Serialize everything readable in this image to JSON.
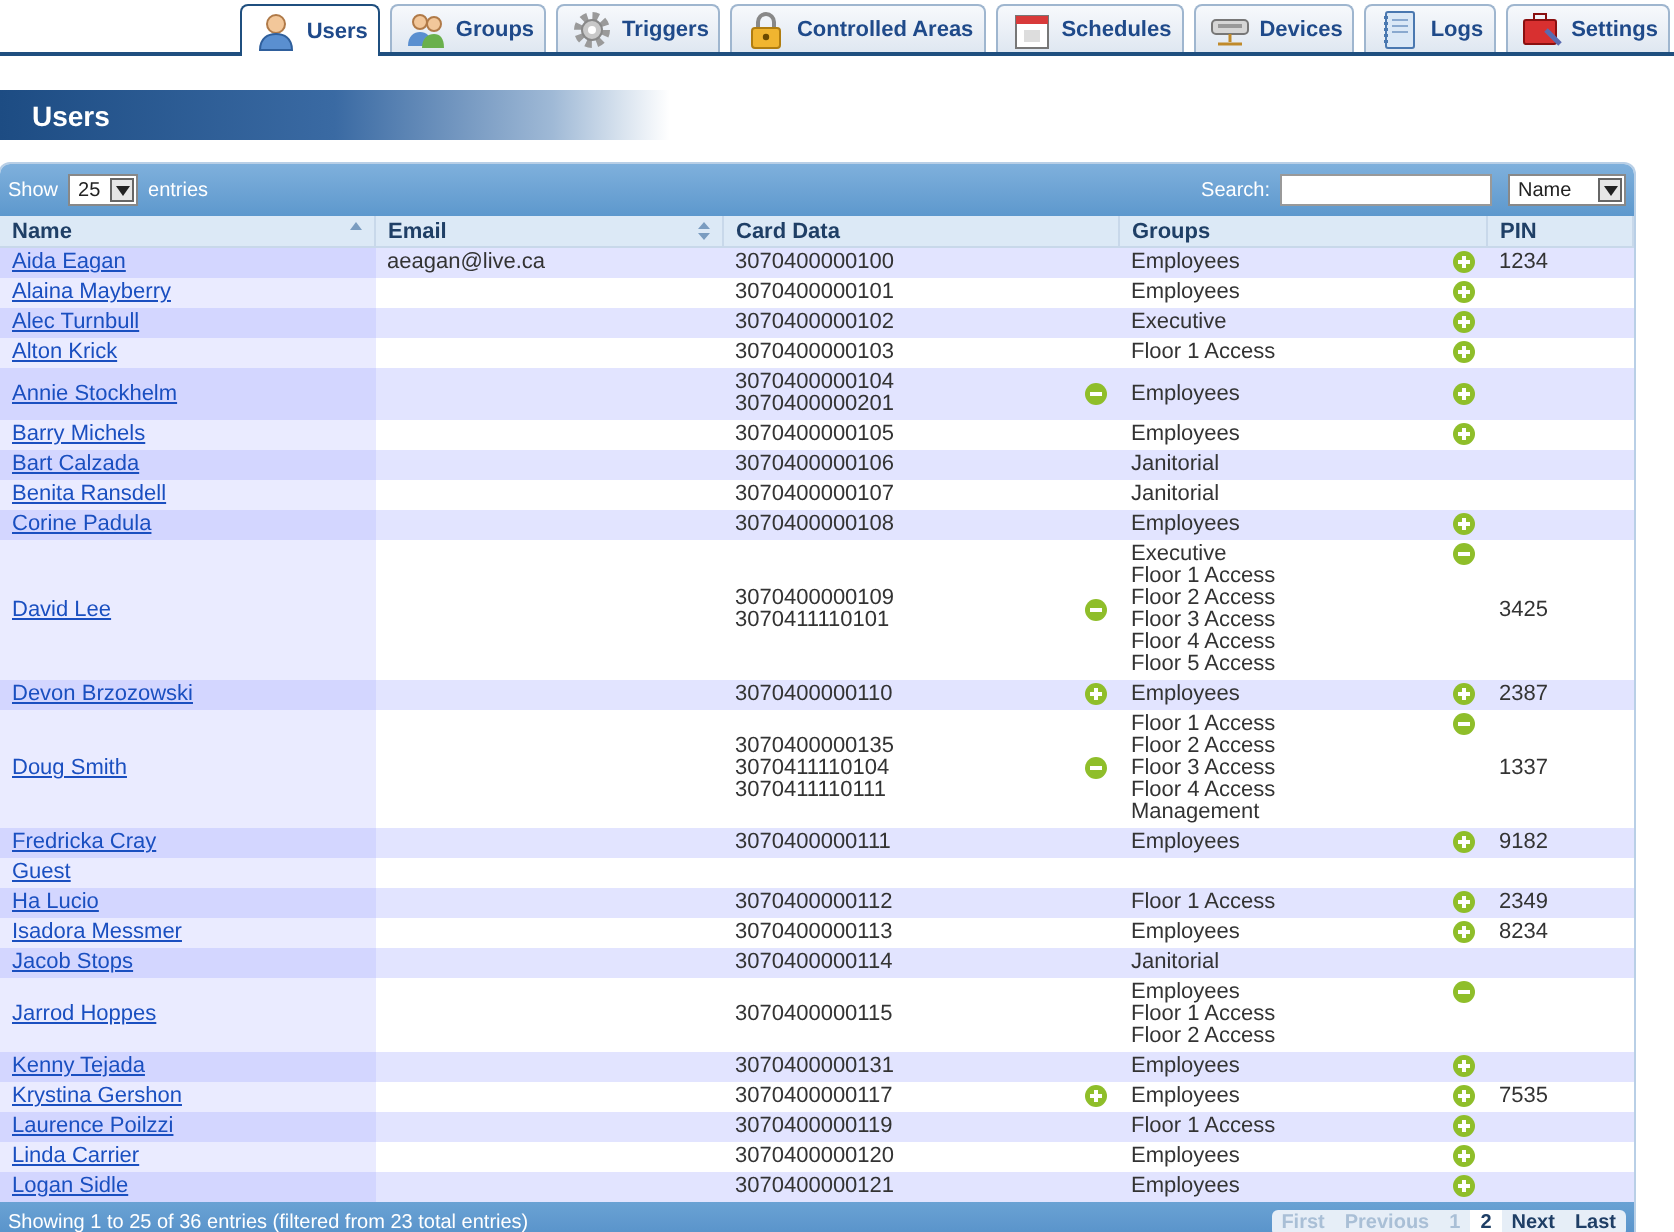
{
  "tabs": [
    {
      "label": "Users",
      "selected": true
    },
    {
      "label": "Groups",
      "selected": false
    },
    {
      "label": "Triggers",
      "selected": false
    },
    {
      "label": "Controlled Areas",
      "selected": false
    },
    {
      "label": "Schedules",
      "selected": false
    },
    {
      "label": "Devices",
      "selected": false
    },
    {
      "label": "Logs",
      "selected": false
    },
    {
      "label": "Settings",
      "selected": false
    }
  ],
  "page_title": "Users",
  "toolbar": {
    "show_label": "Show",
    "page_size": "25",
    "entries_label": "entries",
    "search_label": "Search:",
    "search_field": "Name"
  },
  "columns": [
    {
      "label": "Name",
      "kind": "ascending"
    },
    {
      "label": "Email",
      "kind": "sortable"
    },
    {
      "label": "Card Data",
      "kind": "plain"
    },
    {
      "label": "Groups",
      "kind": "plain"
    },
    {
      "label": "PIN",
      "kind": "plain"
    }
  ],
  "rows": [
    {
      "name": "Aida Eagan",
      "email": "aeagan@live.ca",
      "cards": [
        "3070400000100"
      ],
      "groups": [
        "Employees"
      ],
      "groups_expanded": false,
      "pin": "1234"
    },
    {
      "name": "Alaina Mayberry",
      "cards": [
        "3070400000101"
      ],
      "groups": [
        "Employees"
      ],
      "groups_expanded": false
    },
    {
      "name": "Alec Turnbull",
      "cards": [
        "3070400000102"
      ],
      "groups": [
        "Executive"
      ],
      "groups_expanded": false
    },
    {
      "name": "Alton Krick",
      "cards": [
        "3070400000103"
      ],
      "groups": [
        "Floor 1 Access"
      ],
      "groups_expanded": false
    },
    {
      "name": "Annie Stockhelm",
      "cards": [
        "3070400000104",
        "3070400000201"
      ],
      "cards_expanded": true,
      "groups": [
        "Employees"
      ],
      "groups_expanded": false
    },
    {
      "name": "Barry Michels",
      "cards": [
        "3070400000105"
      ],
      "groups": [
        "Employees"
      ],
      "groups_expanded": false
    },
    {
      "name": "Bart Calzada",
      "cards": [
        "3070400000106"
      ],
      "groups": [
        "Janitorial"
      ]
    },
    {
      "name": "Benita Ransdell",
      "cards": [
        "3070400000107"
      ],
      "groups": [
        "Janitorial"
      ]
    },
    {
      "name": "Corine Padula",
      "cards": [
        "3070400000108"
      ],
      "groups": [
        "Employees"
      ],
      "groups_expanded": false
    },
    {
      "name": "David Lee",
      "cards": [
        "3070400000109",
        "3070411110101"
      ],
      "cards_expanded": true,
      "groups": [
        "Executive",
        "Floor 1 Access",
        "Floor 2 Access",
        "Floor 3 Access",
        "Floor 4 Access",
        "Floor 5 Access"
      ],
      "groups_expanded": true,
      "pin": "3425"
    },
    {
      "name": "Devon Brzozowski",
      "cards": [
        "3070400000110"
      ],
      "cards_expanded": false,
      "groups": [
        "Employees"
      ],
      "groups_expanded": false,
      "pin": "2387"
    },
    {
      "name": "Doug Smith",
      "cards": [
        "3070400000135",
        "3070411110104",
        "3070411110111"
      ],
      "cards_expanded": true,
      "groups": [
        "Floor 1 Access",
        "Floor 2 Access",
        "Floor 3 Access",
        "Floor 4 Access",
        "Management"
      ],
      "groups_expanded": true,
      "pin": "1337"
    },
    {
      "name": "Fredricka Cray",
      "cards": [
        "3070400000111"
      ],
      "groups": [
        "Employees"
      ],
      "groups_expanded": false,
      "pin": "9182"
    },
    {
      "name": "Guest"
    },
    {
      "name": "Ha Lucio",
      "cards": [
        "3070400000112"
      ],
      "groups": [
        "Floor 1 Access"
      ],
      "groups_expanded": false,
      "pin": "2349"
    },
    {
      "name": "Isadora Messmer",
      "cards": [
        "3070400000113"
      ],
      "groups": [
        "Employees"
      ],
      "groups_expanded": false,
      "pin": "8234"
    },
    {
      "name": "Jacob Stops",
      "cards": [
        "3070400000114"
      ],
      "groups": [
        "Janitorial"
      ]
    },
    {
      "name": "Jarrod Hoppes",
      "cards": [
        "3070400000115"
      ],
      "groups": [
        "Employees",
        "Floor 1 Access",
        "Floor 2 Access"
      ],
      "groups_expanded": true
    },
    {
      "name": "Kenny Tejada",
      "cards": [
        "3070400000131"
      ],
      "groups": [
        "Employees"
      ],
      "groups_expanded": false
    },
    {
      "name": "Krystina Gershon",
      "cards": [
        "3070400000117"
      ],
      "cards_expanded": false,
      "groups": [
        "Employees"
      ],
      "groups_expanded": false,
      "pin": "7535"
    },
    {
      "name": "Laurence Poilzzi",
      "cards": [
        "3070400000119"
      ],
      "groups": [
        "Floor 1 Access"
      ],
      "groups_expanded": false
    },
    {
      "name": "Linda Carrier",
      "cards": [
        "3070400000120"
      ],
      "groups": [
        "Employees"
      ],
      "groups_expanded": false
    },
    {
      "name": "Logan Sidle",
      "cards": [
        "3070400000121"
      ],
      "groups": [
        "Employees"
      ],
      "groups_expanded": false
    }
  ],
  "footer": {
    "info": "Showing 1 to 25 of 36 entries (filtered from 23 total entries)",
    "pager": [
      {
        "label": "First",
        "disabled": true,
        "selected": false
      },
      {
        "label": "Previous",
        "disabled": true,
        "selected": false
      },
      {
        "label": "1",
        "disabled": true,
        "selected": false
      },
      {
        "label": "2",
        "disabled": false,
        "selected": true
      },
      {
        "label": "Next",
        "disabled": false,
        "selected": false
      },
      {
        "label": "Last",
        "disabled": false,
        "selected": false
      }
    ]
  }
}
